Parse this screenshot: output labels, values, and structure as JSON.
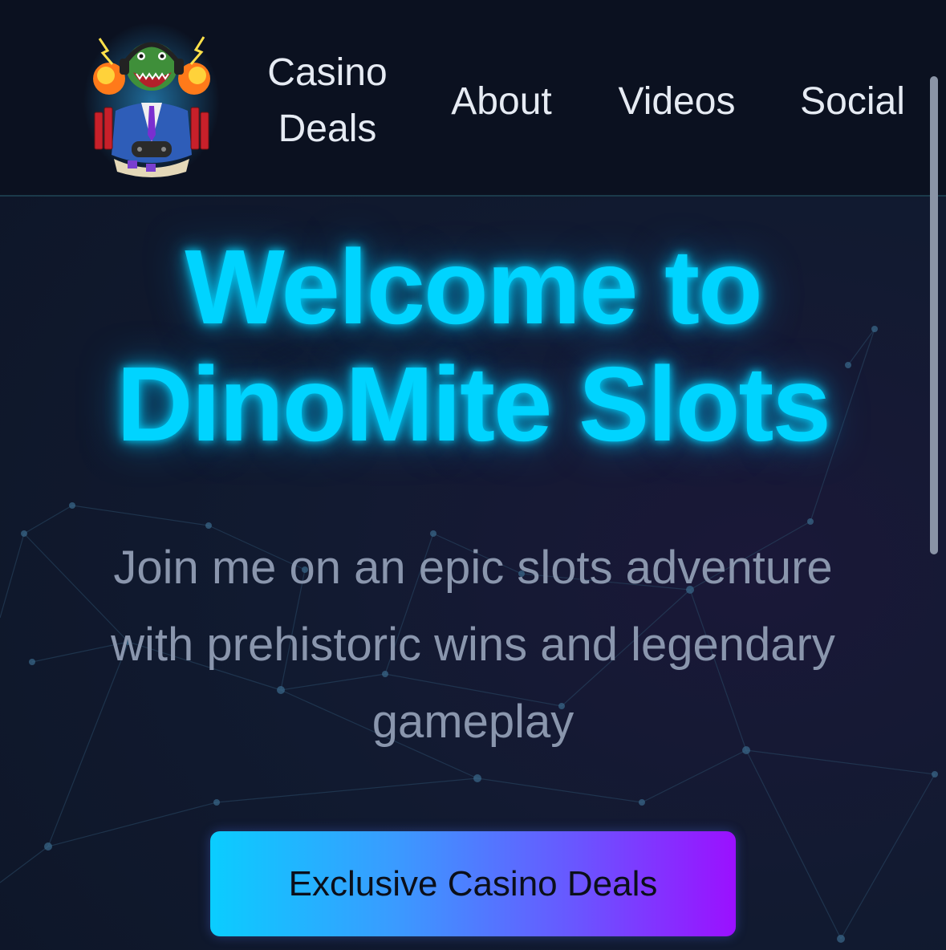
{
  "header": {
    "logo_icon": "dino-gamer-logo-icon",
    "nav": [
      {
        "label_line1": "Casino",
        "label_line2": "Deals"
      },
      {
        "label": "About"
      },
      {
        "label": "Videos"
      },
      {
        "label": "Social"
      }
    ]
  },
  "hero": {
    "title_line1": "Welcome to",
    "title_line2": "DinoMite Slots",
    "subtitle_line1": "Join me on an epic slots adventure",
    "subtitle_line2": "with prehistoric wins and legendary",
    "subtitle_line3": "gameplay",
    "cta_label": "Exclusive Casino Deals"
  },
  "colors": {
    "background": "#0c1222",
    "header_bg": "#0b1120",
    "accent_cyan": "#00d4ff",
    "accent_purple": "#9b10ff",
    "subtitle_text": "#8a96ad",
    "nav_text": "#e6ebf3"
  }
}
